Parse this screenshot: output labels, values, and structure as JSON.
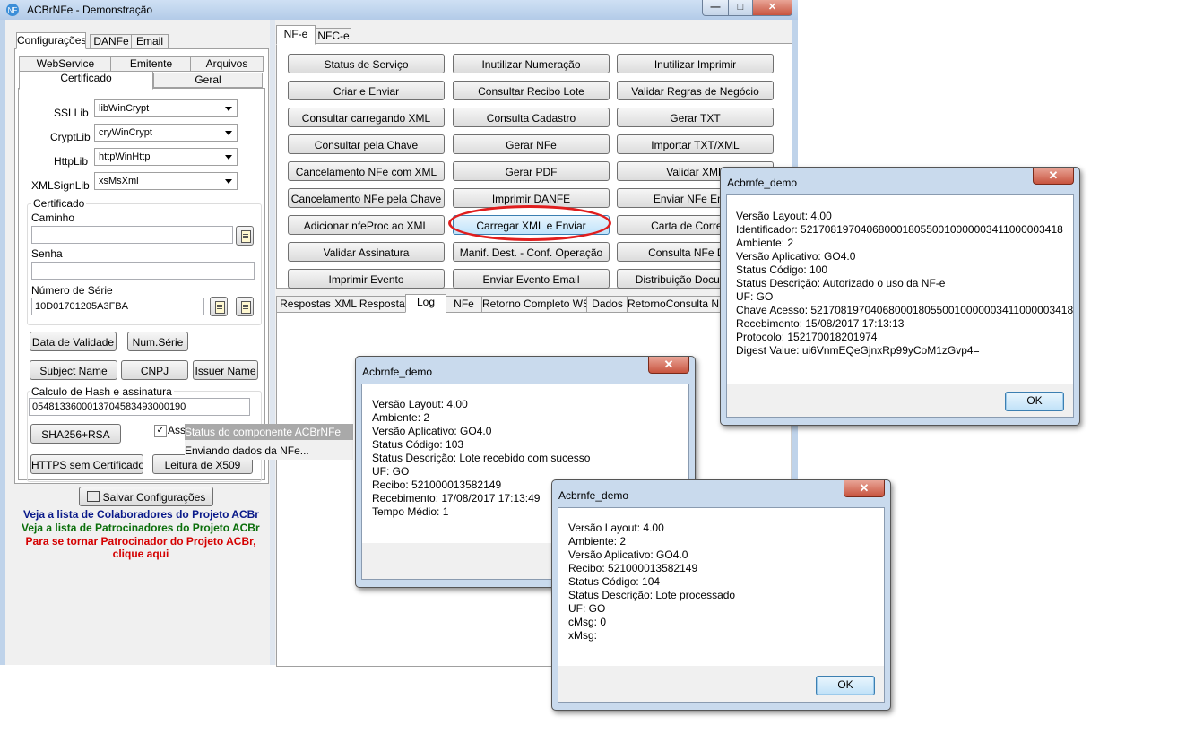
{
  "app": {
    "title": "ACBrNFe - Demonstração",
    "window_buttons": {
      "minimize": "—",
      "maximize": "□",
      "close": "✕"
    }
  },
  "left": {
    "tabs": [
      "Configurações",
      "DANFe",
      "Email"
    ],
    "subtabs_row1": [
      "WebService",
      "Emitente",
      "Arquivos"
    ],
    "subtabs_row2": [
      "Certificado",
      "Geral"
    ],
    "fields": {
      "ssllib": {
        "label": "SSLLib",
        "value": "libWinCrypt"
      },
      "cryptlib": {
        "label": "CryptLib",
        "value": "cryWinCrypt"
      },
      "httplib": {
        "label": "HttpLib",
        "value": "httpWinHttp"
      },
      "xmlsignlib": {
        "label": "XMLSignLib",
        "value": "xsMsXml"
      }
    },
    "cert": {
      "group_label": "Certificado",
      "caminho_label": "Caminho",
      "caminho_value": "",
      "senha_label": "Senha",
      "senha_value": "",
      "serie_label": "Número de Série",
      "serie_value": "10D01701205A3FBA"
    },
    "buttons": {
      "data_validade": "Data de Validade",
      "num_serie": "Num.Série",
      "subject_name": "Subject Name",
      "cnpj": "CNPJ",
      "issuer_name": "Issuer Name",
      "sha": "SHA256+RSA",
      "https": "HTTPS sem Certificado",
      "leitura": "Leitura de X509",
      "salvar": "Salvar Configurações"
    },
    "hash": {
      "label": "Calculo de Hash e assinatura",
      "value": "0548133600013704583493000190",
      "checkbox_label": "Assi",
      "checked": true
    },
    "links": {
      "colaboradores": "Veja a lista de Colaboradores do Projeto ACBr",
      "patrocinadores": "Veja a lista de Patrocinadores do Projeto ACBr",
      "tornar1": "Para se tornar Patrocinador do Projeto ACBr,",
      "tornar2": "clique aqui"
    }
  },
  "status_popup": {
    "title": "Status do componente ACBrNFe",
    "text": "Enviando dados da NFe..."
  },
  "right": {
    "tabs": [
      "NF-e",
      "NFC-e"
    ],
    "buttons": [
      [
        "Status de Serviço",
        "Inutilizar Numeração",
        "Inutilizar Imprimir"
      ],
      [
        "Criar e Enviar",
        "Consultar Recibo Lote",
        "Validar Regras de Negócio"
      ],
      [
        "Consultar carregando XML",
        "Consulta Cadastro",
        "Gerar TXT"
      ],
      [
        "Consultar pela Chave",
        "Gerar NFe",
        "Importar TXT/XML"
      ],
      [
        "Cancelamento NFe com XML",
        "Gerar PDF",
        "Validar XML"
      ],
      [
        "Cancelamento NFe pela Chave",
        "Imprimir DANFE",
        "Enviar NFe Email"
      ],
      [
        "Adicionar nfeProc ao XML",
        "Carregar XML e Enviar",
        "Carta de Correção"
      ],
      [
        "Validar Assinatura",
        "Manif. Dest. - Conf. Operação",
        "Consulta NFe Dest."
      ],
      [
        "Imprimir Evento",
        "Enviar Evento Email",
        "Distribuição Documentos"
      ]
    ],
    "highlight_color": "#e01e1e",
    "bottom_tabs": [
      "Respostas",
      "XML Resposta",
      "Log",
      "NFe",
      "Retorno Completo WS",
      "Dados",
      "RetornoConsulta NFe"
    ]
  },
  "dialog1": {
    "title": "Acbrnfe_demo",
    "close": "✕",
    "lines": [
      "Versão Layout: 4.00",
      "Identificador: 52170819704068000180550010000003411000003418",
      "Ambiente: 2",
      "Versão Aplicativo: GO4.0",
      "Status Código: 100",
      "Status Descrição: Autorizado o uso da NF-e",
      "UF: GO",
      "Chave Acesso: 52170819704068000180550010000003411000003418",
      "Recebimento: 15/08/2017 17:13:13",
      "Protocolo: 152170018201974",
      "Digest Value: ui6VnmEQeGjnxRp99yCoM1zGvp4="
    ],
    "ok": "OK"
  },
  "dialog2": {
    "title": "Acbrnfe_demo",
    "close": "✕",
    "lines": [
      "Versão Layout: 4.00",
      "Ambiente: 2",
      "Versão Aplicativo: GO4.0",
      "Status Código: 103",
      "Status Descrição: Lote recebido com sucesso",
      "UF: GO",
      "Recibo: 521000013582149",
      "Recebimento: 17/08/2017 17:13:49",
      "Tempo Médio: 1"
    ]
  },
  "dialog3": {
    "title": "Acbrnfe_demo",
    "close": "✕",
    "lines": [
      "Versão Layout: 4.00",
      "Ambiente: 2",
      "Versão Aplicativo: GO4.0",
      "Recibo: 521000013582149",
      "Status Código: 104",
      "Status Descrição: Lote processado",
      "UF: GO",
      "cMsg: 0",
      "xMsg:"
    ],
    "ok": "OK"
  }
}
